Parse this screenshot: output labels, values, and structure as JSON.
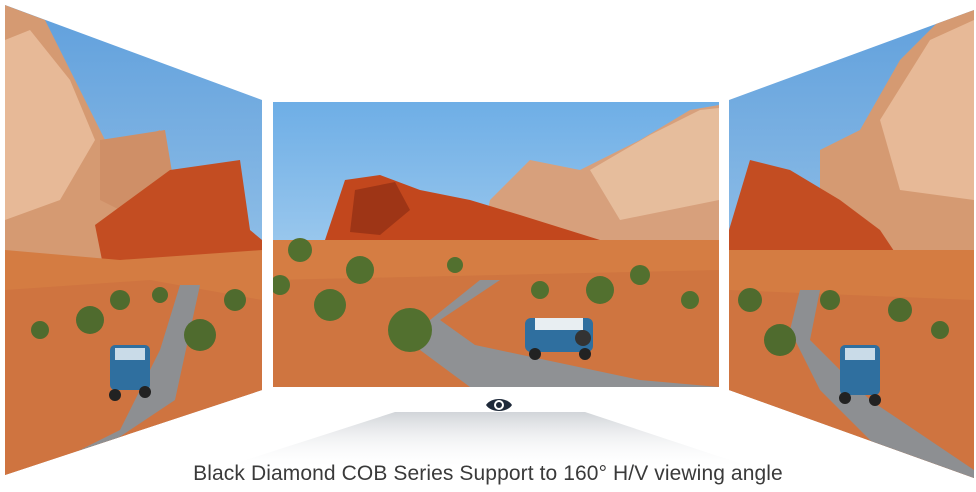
{
  "caption": "Black Diamond COB Series Support to 160°  H/V viewing angle",
  "panels": [
    {
      "id": "left",
      "scene": "desert canyon road with blue off-road vehicle",
      "perspective": "angled-left"
    },
    {
      "id": "center",
      "scene": "desert canyon road with blue off-road vehicle",
      "perspective": "front"
    },
    {
      "id": "right",
      "scene": "desert canyon road with blue off-road vehicle",
      "perspective": "angled-right"
    }
  ],
  "icons": {
    "viewer": "eye-icon"
  },
  "colors": {
    "sky": "#7fb6e6",
    "cliff": "#c9562a",
    "sand": "#d9874a",
    "road": "#8d8f92",
    "vehicle": "#2f6f9f",
    "caption": "#3a3a3a"
  }
}
